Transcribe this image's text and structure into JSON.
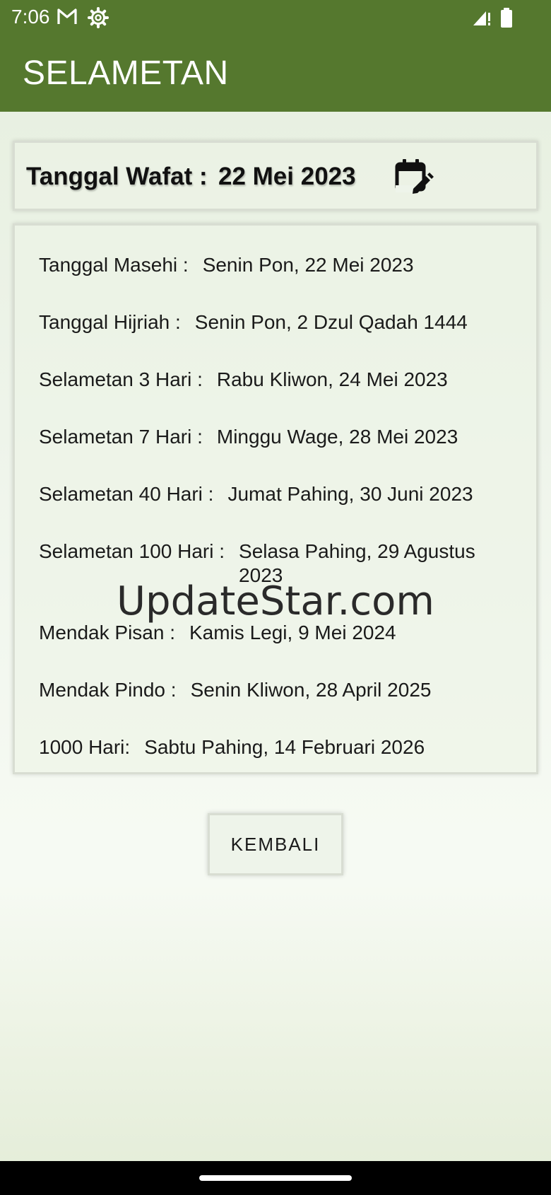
{
  "status_bar": {
    "time": "7:06",
    "icons": [
      "gmail-icon",
      "settings-gear-icon",
      "signal-icon",
      "battery-icon"
    ]
  },
  "app_bar": {
    "title": "SELAMETAN",
    "color": "#55782e"
  },
  "date_card": {
    "label": "Tanggal Wafat :",
    "value": "22 Mei 2023",
    "calendar_icon": "calendar-edit-icon"
  },
  "results": [
    {
      "label": "Tanggal Masehi :",
      "value": "Senin Pon, 22 Mei 2023"
    },
    {
      "label": "Tanggal Hijriah :",
      "value": "Senin Pon, 2 Dzul Qadah 1444"
    },
    {
      "label": "Selametan 3 Hari :",
      "value": "Rabu Kliwon, 24 Mei 2023"
    },
    {
      "label": "Selametan 7 Hari :",
      "value": "Minggu Wage, 28 Mei 2023"
    },
    {
      "label": "Selametan 40 Hari :",
      "value": "Jumat Pahing, 30 Juni 2023"
    },
    {
      "label": "Selametan 100 Hari :",
      "value": "Selasa Pahing, 29 Agustus 2023"
    },
    {
      "label": "Mendak Pisan :",
      "value": "Kamis Legi, 9 Mei 2024"
    },
    {
      "label": "Mendak Pindo :",
      "value": "Senin Kliwon, 28 April 2025"
    },
    {
      "label": "1000 Hari:",
      "value": "Sabtu Pahing, 14 Februari 2026"
    }
  ],
  "watermark": "UpdateStar.com",
  "back_button": {
    "label": "KEMBALI"
  }
}
